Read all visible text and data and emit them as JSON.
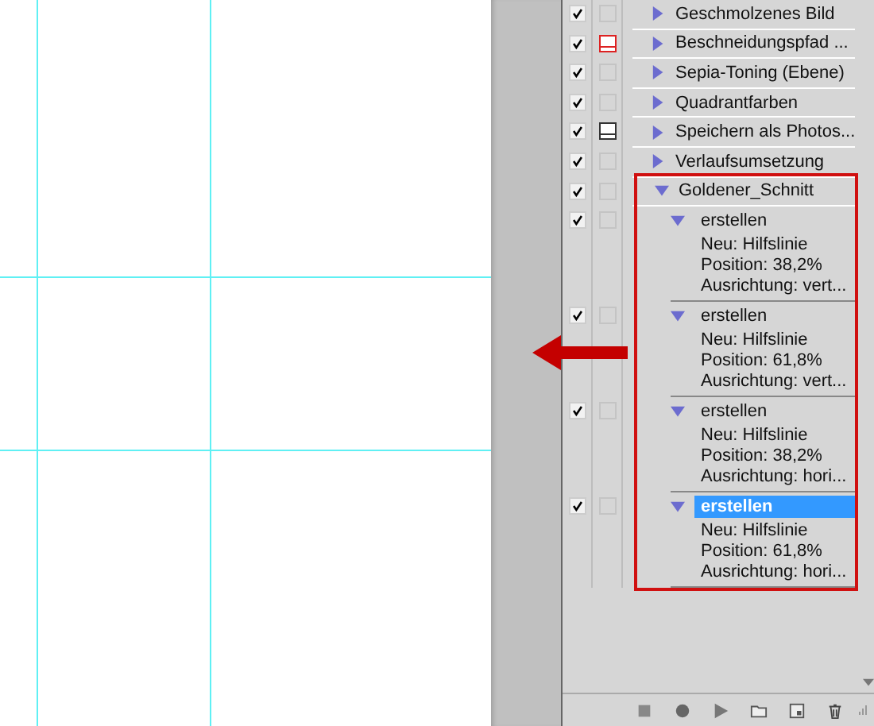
{
  "actions": [
    {
      "name": "Geschmolzenes Bild",
      "checked": true,
      "dialog": false,
      "expanded": false
    },
    {
      "name": "Beschneidungspfad ...",
      "checked": true,
      "dialog": true,
      "partial": true,
      "expanded": false
    },
    {
      "name": "Sepia-Toning (Ebene)",
      "checked": true,
      "dialog": false,
      "expanded": false
    },
    {
      "name": "Quadrantfarben",
      "checked": true,
      "dialog": false,
      "expanded": false
    },
    {
      "name": "Speichern als Photos...",
      "checked": true,
      "dialog": true,
      "partial": false,
      "expanded": false
    },
    {
      "name": "Verlaufsumsetzung",
      "checked": true,
      "dialog": false,
      "expanded": false
    },
    {
      "name": "Goldener_Schnitt",
      "checked": true,
      "dialog": false,
      "expanded": true,
      "steps": [
        {
          "name": "erstellen",
          "checked": true,
          "selected": false,
          "details": [
            "Neu: Hilfslinie",
            "Position: 38,2%",
            "Ausrichtung: vert..."
          ]
        },
        {
          "name": "erstellen",
          "checked": true,
          "selected": false,
          "details": [
            "Neu: Hilfslinie",
            "Position: 61,8%",
            "Ausrichtung: vert..."
          ]
        },
        {
          "name": "erstellen",
          "checked": true,
          "selected": false,
          "details": [
            "Neu: Hilfslinie",
            "Position: 38,2%",
            "Ausrichtung: hori..."
          ]
        },
        {
          "name": "erstellen",
          "checked": true,
          "selected": true,
          "details": [
            "Neu: Hilfslinie",
            "Position: 61,8%",
            "Ausrichtung: hori..."
          ]
        }
      ]
    }
  ]
}
